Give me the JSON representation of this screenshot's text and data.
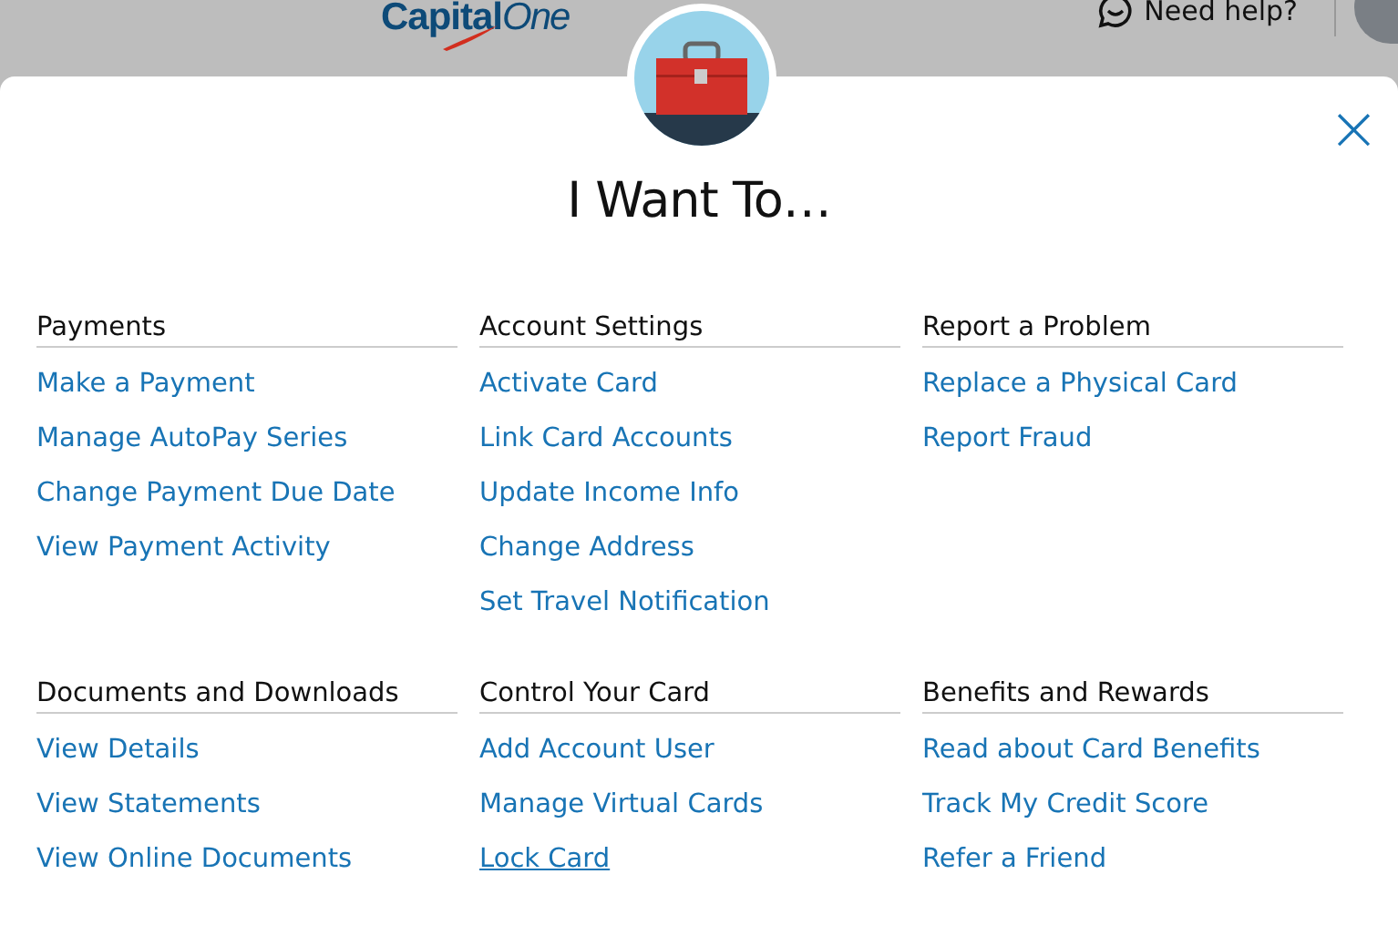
{
  "header": {
    "logo": {
      "main": "Capital",
      "tail": "One"
    },
    "help": "Need help?"
  },
  "dialog": {
    "title": "I Want To…",
    "close": "×",
    "sections": [
      {
        "heading": "Payments",
        "links": [
          {
            "label": "Make a Payment",
            "hovered": false
          },
          {
            "label": "Manage AutoPay Series",
            "hovered": false
          },
          {
            "label": "Change Payment Due Date",
            "hovered": false
          },
          {
            "label": "View Payment Activity",
            "hovered": false
          }
        ]
      },
      {
        "heading": "Account Settings",
        "links": [
          {
            "label": "Activate Card",
            "hovered": false
          },
          {
            "label": "Link Card Accounts",
            "hovered": false
          },
          {
            "label": "Update Income Info",
            "hovered": false
          },
          {
            "label": "Change Address",
            "hovered": false
          },
          {
            "label": "Set Travel Notification",
            "hovered": false
          }
        ]
      },
      {
        "heading": "Report a Problem",
        "links": [
          {
            "label": "Replace a Physical Card",
            "hovered": false
          },
          {
            "label": "Report Fraud",
            "hovered": false
          }
        ]
      },
      {
        "heading": "Documents and Downloads",
        "links": [
          {
            "label": "View Details",
            "hovered": false
          },
          {
            "label": "View Statements",
            "hovered": false
          },
          {
            "label": "View Online Documents",
            "hovered": false
          }
        ]
      },
      {
        "heading": "Control Your Card",
        "links": [
          {
            "label": "Add Account User",
            "hovered": false
          },
          {
            "label": "Manage Virtual Cards",
            "hovered": false
          },
          {
            "label": "Lock Card",
            "hovered": true
          }
        ]
      },
      {
        "heading": "Benefits and Rewards",
        "links": [
          {
            "label": "Read about Card Benefits",
            "hovered": false
          },
          {
            "label": "Track My Credit Score",
            "hovered": false
          },
          {
            "label": "Refer a Friend",
            "hovered": false
          }
        ]
      }
    ]
  }
}
